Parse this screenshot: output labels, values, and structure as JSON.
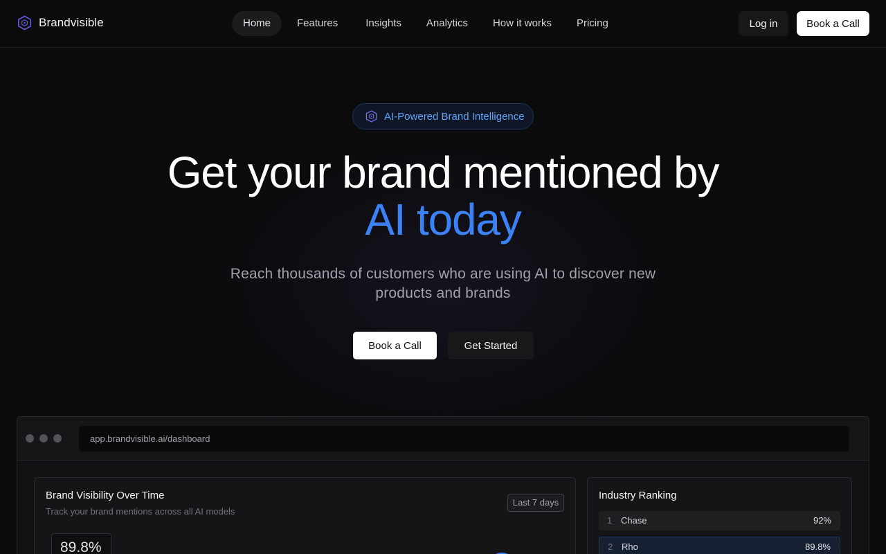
{
  "brand": {
    "name": "Brandvisible",
    "icon": "hexagon-logo-icon"
  },
  "nav": {
    "links": [
      {
        "label": "Home",
        "active": true
      },
      {
        "label": "Features",
        "active": false
      },
      {
        "label": "Insights",
        "active": false
      },
      {
        "label": "Analytics",
        "active": false
      },
      {
        "label": "How it works",
        "active": false
      },
      {
        "label": "Pricing",
        "active": false
      }
    ],
    "login_label": "Log in",
    "book_call_label": "Book a Call"
  },
  "hero": {
    "badge_text": "AI-Powered Brand Intelligence",
    "badge_icon": "hexagon-icon",
    "title_line1": "Get your brand mentioned by",
    "title_line2": "AI today",
    "subtitle": "Reach thousands of customers who are using AI to discover new products and brands",
    "primary_cta": "Book a Call",
    "secondary_cta": "Get Started"
  },
  "dashboard": {
    "url": "app.brandvisible.ai/dashboard",
    "visibility_card": {
      "title": "Brand Visibility Over Time",
      "subtitle": "Track your brand mentions across all AI models",
      "range": "Last 7 days",
      "metric": "89.8%"
    },
    "ranking_card": {
      "title": "Industry Ranking",
      "rows": [
        {
          "rank": "1",
          "name": "Chase",
          "value": "92%"
        },
        {
          "rank": "2",
          "name": "Rho",
          "value": "89.8%"
        }
      ]
    }
  },
  "colors": {
    "accent": "#3b82f6",
    "badge_text": "#60a5fa",
    "background": "#0b0b0c"
  }
}
